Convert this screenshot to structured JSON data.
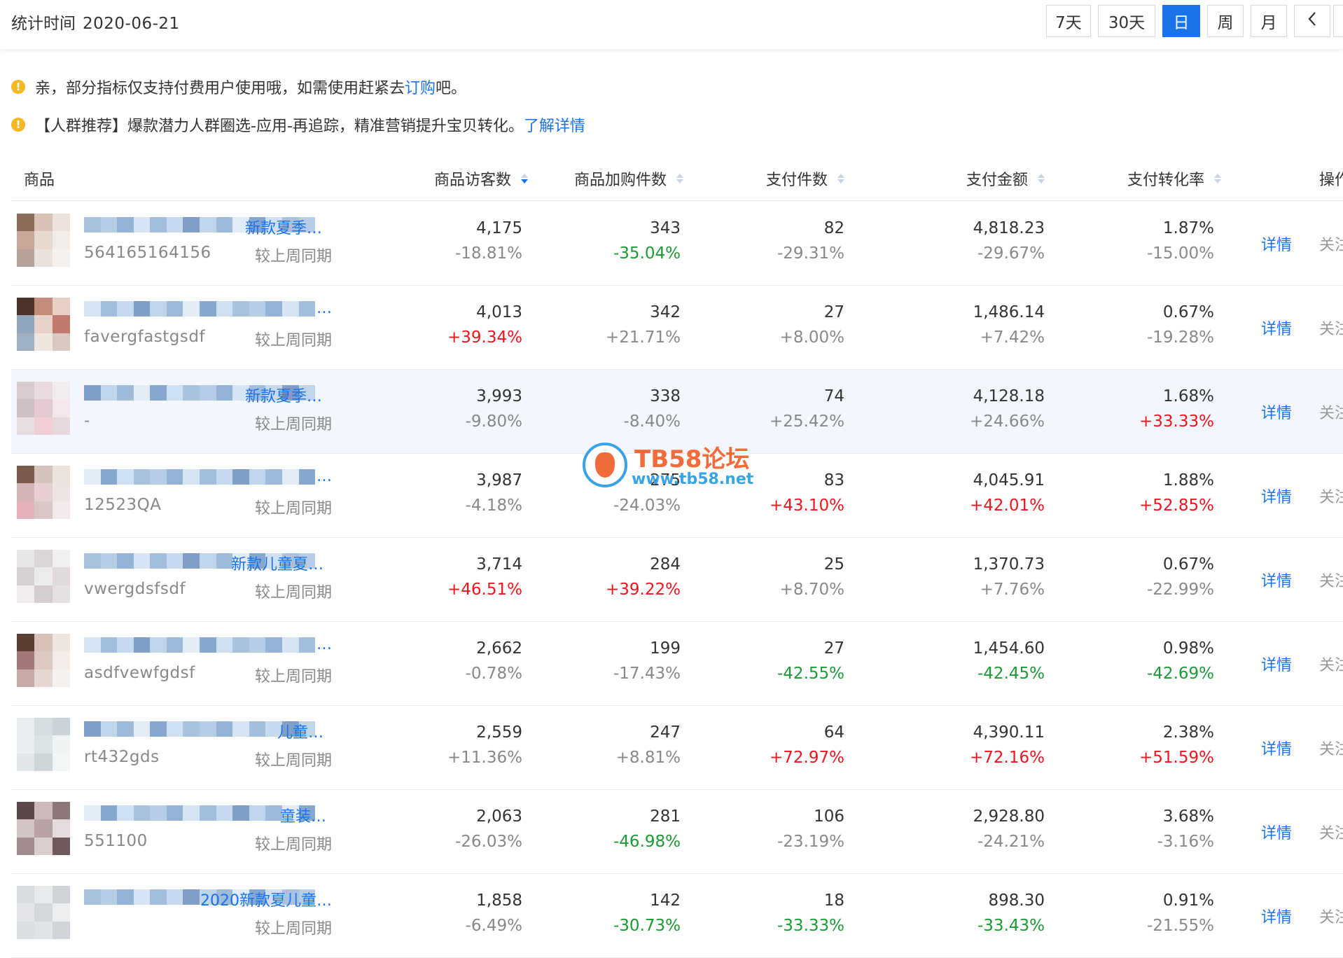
{
  "header": {
    "stat_label": "统计时间",
    "stat_date": "2020-06-21",
    "ranges": [
      "7天",
      "30天",
      "日",
      "周",
      "月"
    ],
    "active_range": "日",
    "prev_icon": "chevron-left-icon"
  },
  "notices": {
    "n1_text": "亲，部分指标仅支持付费用户使用哦，如需使用赶紧去",
    "n1_link": "订购",
    "n1_suffix": "吧。",
    "n2_text": "【人群推荐】爆款潜力人群圈选-应用-再追踪，精准营销提升宝贝转化。",
    "n2_link": "了解详情"
  },
  "table": {
    "columns": {
      "product": "商品",
      "visitors": "商品访客数",
      "cart": "商品加购件数",
      "pay_items": "支付件数",
      "pay_amount": "支付金额",
      "conversion": "支付转化率",
      "action": "操作"
    },
    "compare_label": "较上周同期",
    "detail_label": "详情",
    "follow_label": "关注",
    "rows": [
      {
        "title_frag": "新款夏季…",
        "id": "564165164156",
        "visitors": "4,175",
        "visitors_chg": "-18.81%",
        "cart": "343",
        "cart_chg": "-35.04%",
        "pay_items": "82",
        "pay_items_chg": "-29.31%",
        "pay_amount": "4,818.23",
        "pay_amount_chg": "-29.67%",
        "conversion": "1.87%",
        "conversion_chg": "-15.00%"
      },
      {
        "title_frag": "…",
        "id": "favergfastgsdf",
        "visitors": "4,013",
        "visitors_chg": "+39.34%",
        "cart": "342",
        "cart_chg": "+21.71%",
        "pay_items": "27",
        "pay_items_chg": "+8.00%",
        "pay_amount": "1,486.14",
        "pay_amount_chg": "+7.42%",
        "conversion": "0.67%",
        "conversion_chg": "-19.28%"
      },
      {
        "title_frag": "新款夏季…",
        "id": "-",
        "visitors": "3,993",
        "visitors_chg": "-9.80%",
        "cart": "338",
        "cart_chg": "-8.40%",
        "pay_items": "74",
        "pay_items_chg": "+25.42%",
        "pay_amount": "4,128.18",
        "pay_amount_chg": "+24.66%",
        "conversion": "1.68%",
        "conversion_chg": "+33.33%"
      },
      {
        "title_frag": "…",
        "id": "12523QA",
        "visitors": "3,987",
        "visitors_chg": "-4.18%",
        "cart": "275",
        "cart_chg": "-24.03%",
        "pay_items": "83",
        "pay_items_chg": "+43.10%",
        "pay_amount": "4,045.91",
        "pay_amount_chg": "+42.01%",
        "conversion": "1.88%",
        "conversion_chg": "+52.85%"
      },
      {
        "title_frag": "新款儿童夏…",
        "id": "vwergdsfsdf",
        "visitors": "3,714",
        "visitors_chg": "+46.51%",
        "cart": "284",
        "cart_chg": "+39.22%",
        "pay_items": "25",
        "pay_items_chg": "+8.70%",
        "pay_amount": "1,370.73",
        "pay_amount_chg": "+7.76%",
        "conversion": "0.67%",
        "conversion_chg": "-22.99%"
      },
      {
        "title_frag": "…",
        "id": "asdfvewfgdsf",
        "visitors": "2,662",
        "visitors_chg": "-0.78%",
        "cart": "199",
        "cart_chg": "-17.43%",
        "pay_items": "27",
        "pay_items_chg": "-42.55%",
        "pay_amount": "1,454.60",
        "pay_amount_chg": "-42.45%",
        "conversion": "0.98%",
        "conversion_chg": "-42.69%"
      },
      {
        "title_frag": "儿童…",
        "id": "rt432gds",
        "visitors": "2,559",
        "visitors_chg": "+11.36%",
        "cart": "247",
        "cart_chg": "+8.81%",
        "pay_items": "64",
        "pay_items_chg": "+72.97%",
        "pay_amount": "4,390.11",
        "pay_amount_chg": "+72.16%",
        "conversion": "2.38%",
        "conversion_chg": "+51.59%"
      },
      {
        "title_frag": "童装…",
        "id": "551100",
        "visitors": "2,063",
        "visitors_chg": "-26.03%",
        "cart": "281",
        "cart_chg": "-46.98%",
        "pay_items": "106",
        "pay_items_chg": "-23.19%",
        "pay_amount": "2,928.80",
        "pay_amount_chg": "-24.21%",
        "conversion": "3.68%",
        "conversion_chg": "-3.16%"
      },
      {
        "title_frag": "2020新款夏儿童…",
        "id": "",
        "visitors": "1,858",
        "visitors_chg": "-6.49%",
        "cart": "142",
        "cart_chg": "-30.73%",
        "pay_items": "18",
        "pay_items_chg": "-33.33%",
        "pay_amount": "898.30",
        "pay_amount_chg": "-33.43%",
        "conversion": "0.91%",
        "conversion_chg": "-21.55%"
      }
    ]
  },
  "watermark": {
    "title": "TB58论坛",
    "url": "www.tb58.net"
  },
  "colors": {
    "accent": "#1a73e8",
    "up": "#f0141e",
    "down": "#1c9a33",
    "warn": "#f5b823"
  }
}
